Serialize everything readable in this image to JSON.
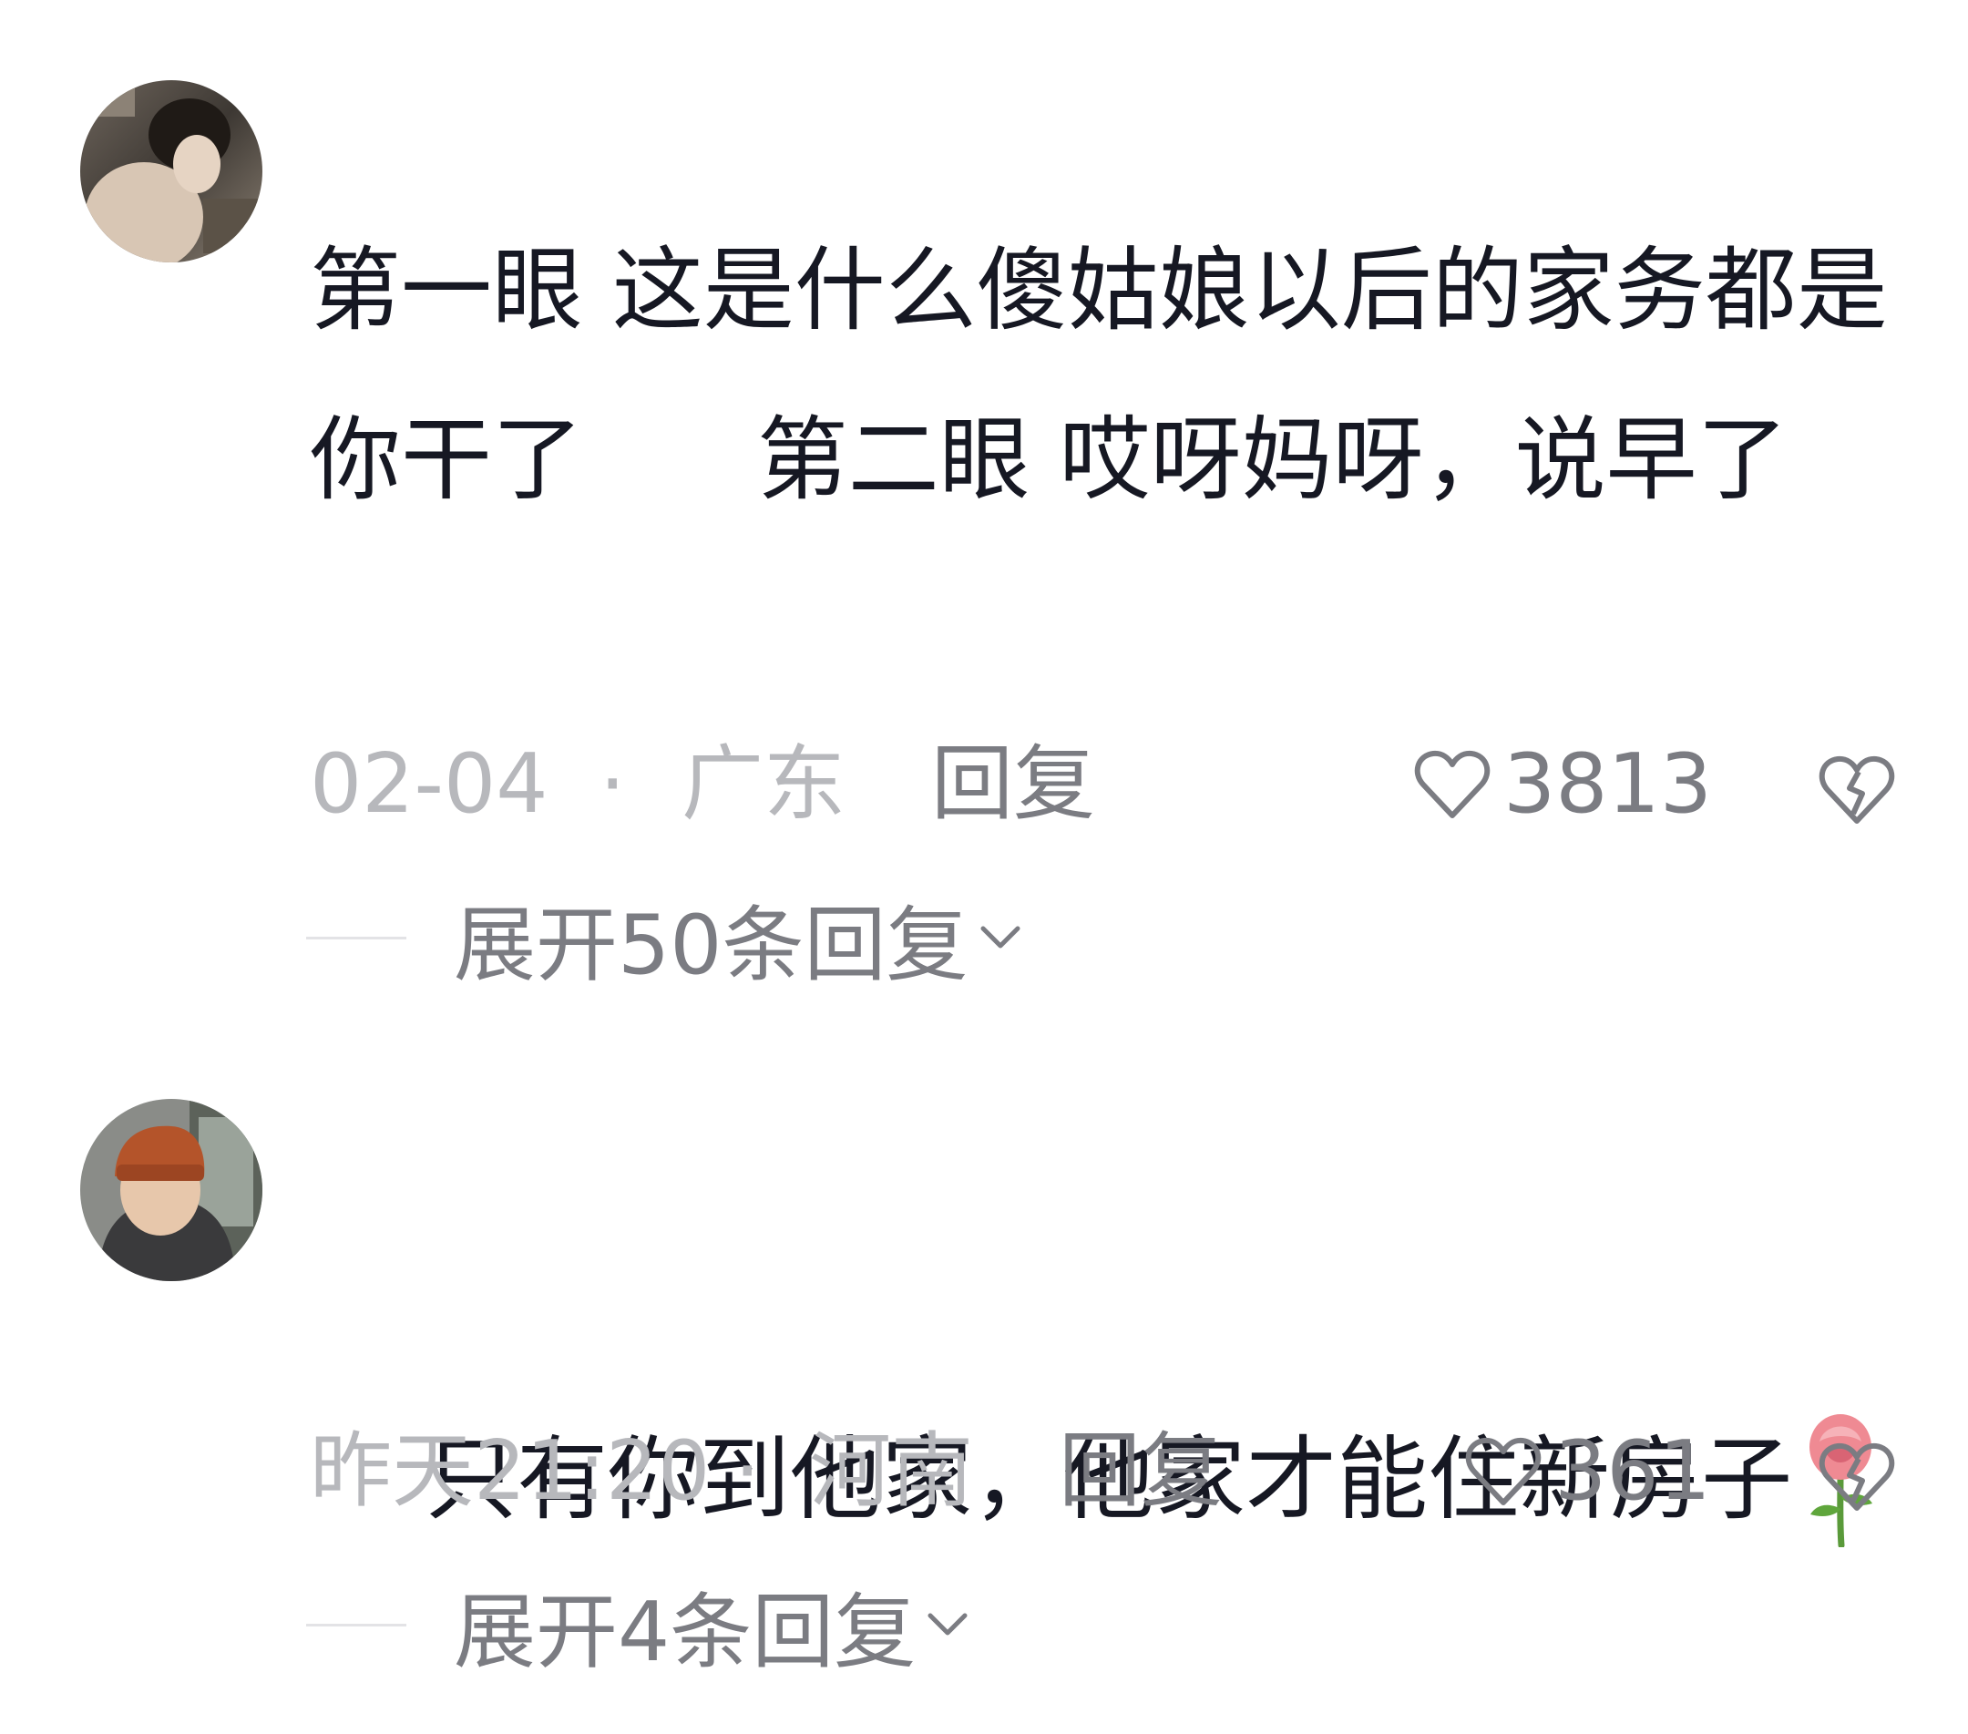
{
  "comments": [
    {
      "avatar": "user-avatar-1",
      "text": "第一眼 这是什么傻姑娘以后的家务都是你干了      第二眼 哎呀妈呀，说早了",
      "date": "02-04",
      "separator": "·",
      "region": "广东",
      "reply_label": "回复",
      "likes": "3813",
      "expand_label": "展开50条回复"
    },
    {
      "avatar": "user-avatar-2",
      "text": "只有你到他家，他家才能住新房子",
      "emoji": "rose-emoji",
      "date": "昨天21:20",
      "separator": "·",
      "region": "河南",
      "reply_label": "回复",
      "likes": "361",
      "expand_label": "展开4条回复"
    }
  ],
  "icons": {
    "like": "heart-outline-icon",
    "dislike": "broken-heart-icon",
    "expand": "chevron-down-icon"
  },
  "colors": {
    "text": "#161823",
    "meta": "#b7b8bc",
    "action": "#7b7c82"
  }
}
